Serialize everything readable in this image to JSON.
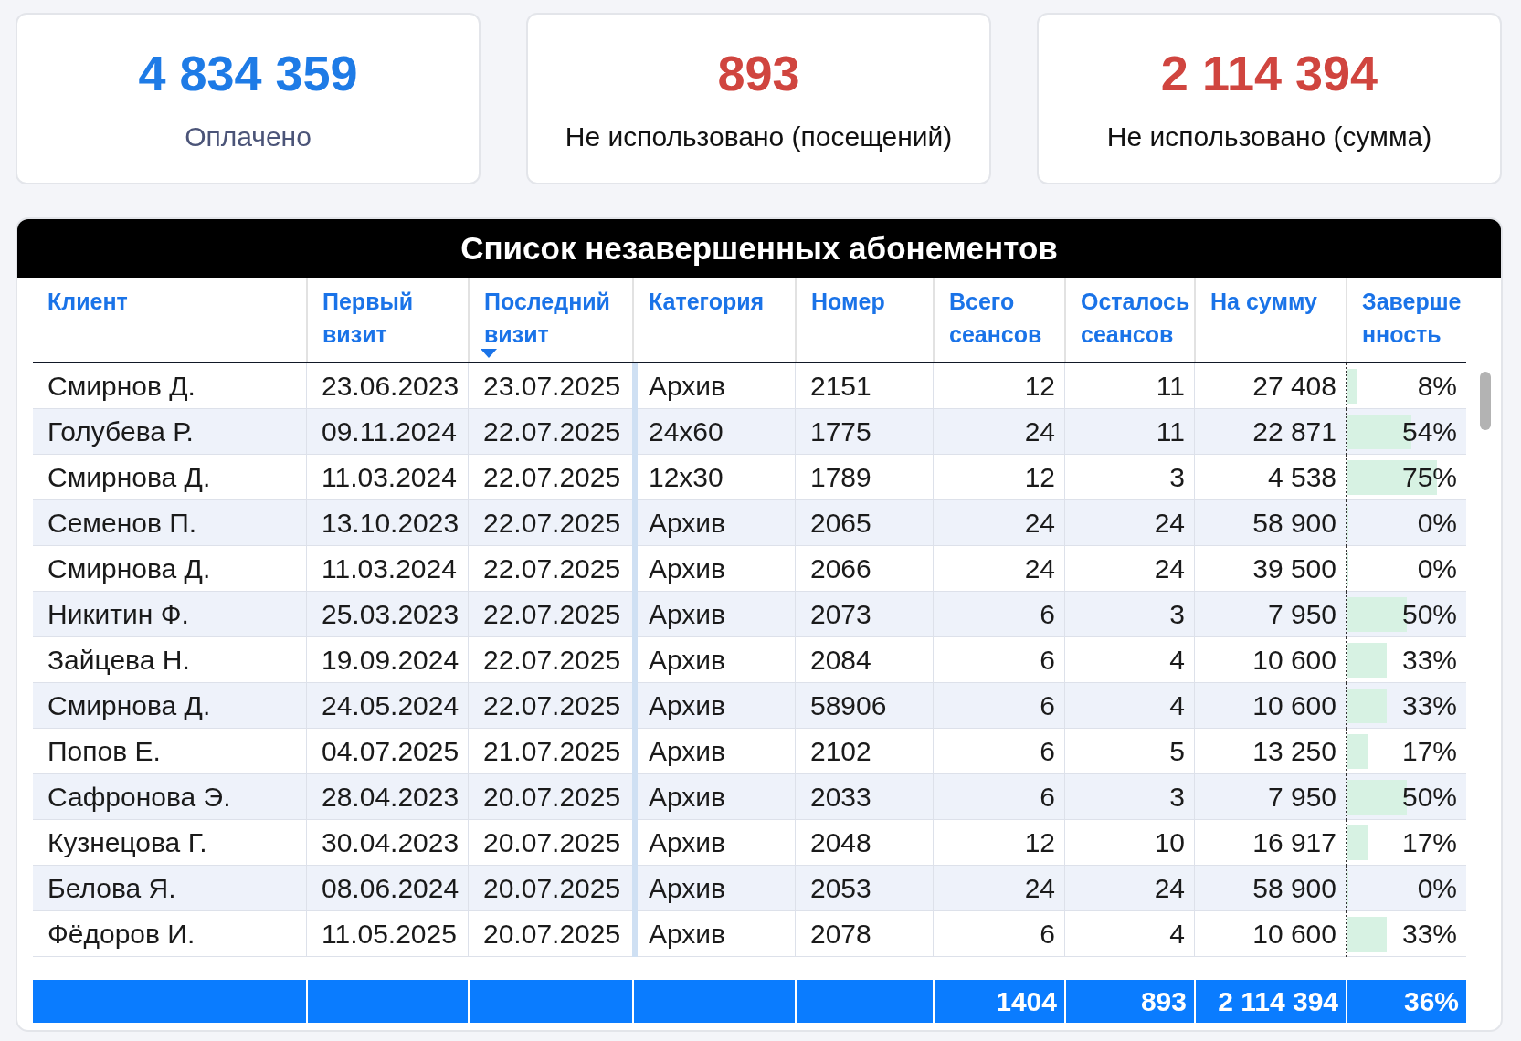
{
  "cards": [
    {
      "value": "4 834 359",
      "label": "Оплачено",
      "color": "#1e7be6",
      "muted": true
    },
    {
      "value": "893",
      "label": "Не использовано (посещений)",
      "color": "#d0453f",
      "muted": false
    },
    {
      "value": "2 114 394",
      "label": "Не использовано (сумма)",
      "color": "#d0453f",
      "muted": false
    }
  ],
  "table": {
    "title": "Список незавершенных абонементов",
    "columns": [
      {
        "label": "Клиент",
        "sorted": false
      },
      {
        "label": "Первый визит",
        "sorted": false
      },
      {
        "label": "Последний визит",
        "sorted": true
      },
      {
        "label": "Категория",
        "sorted": false
      },
      {
        "label": "Номер",
        "sorted": false
      },
      {
        "label": "Всего сеансов",
        "sorted": false
      },
      {
        "label": "Осталось сеансов",
        "sorted": false
      },
      {
        "label": "На сумму",
        "sorted": false
      },
      {
        "label": "Завершенность",
        "sorted": false
      }
    ],
    "rows": [
      {
        "cells": [
          "Смирнов Д.",
          "23.06.2023",
          "23.07.2025",
          "Архив",
          "2151",
          "12",
          "11",
          "27 408"
        ],
        "completion": "8%",
        "level": 0.08
      },
      {
        "cells": [
          "Голубева Р.",
          "09.11.2024",
          "22.07.2025",
          "24x60",
          "1775",
          "24",
          "11",
          "22 871"
        ],
        "completion": "54%",
        "level": 0.54
      },
      {
        "cells": [
          "Смирнова Д.",
          "11.03.2024",
          "22.07.2025",
          "12x30",
          "1789",
          "12",
          "3",
          "4 538"
        ],
        "completion": "75%",
        "level": 0.75
      },
      {
        "cells": [
          "Семенов П.",
          "13.10.2023",
          "22.07.2025",
          "Архив",
          "2065",
          "24",
          "24",
          "58 900"
        ],
        "completion": "0%",
        "level": 0
      },
      {
        "cells": [
          "Смирнова Д.",
          "11.03.2024",
          "22.07.2025",
          "Архив",
          "2066",
          "24",
          "24",
          "39 500"
        ],
        "completion": "0%",
        "level": 0
      },
      {
        "cells": [
          "Никитин Ф.",
          "25.03.2023",
          "22.07.2025",
          "Архив",
          "2073",
          "6",
          "3",
          "7 950"
        ],
        "completion": "50%",
        "level": 0.5
      },
      {
        "cells": [
          "Зайцева Н.",
          "19.09.2024",
          "22.07.2025",
          "Архив",
          "2084",
          "6",
          "4",
          "10 600"
        ],
        "completion": "33%",
        "level": 0.33
      },
      {
        "cells": [
          "Смирнова Д.",
          "24.05.2024",
          "22.07.2025",
          "Архив",
          "58906",
          "6",
          "4",
          "10 600"
        ],
        "completion": "33%",
        "level": 0.33
      },
      {
        "cells": [
          "Попов Е.",
          "04.07.2025",
          "21.07.2025",
          "Архив",
          "2102",
          "6",
          "5",
          "13 250"
        ],
        "completion": "17%",
        "level": 0.17
      },
      {
        "cells": [
          "Сафронова Э.",
          "28.04.2023",
          "20.07.2025",
          "Архив",
          "2033",
          "6",
          "3",
          "7 950"
        ],
        "completion": "50%",
        "level": 0.5
      },
      {
        "cells": [
          "Кузнецова Г.",
          "30.04.2023",
          "20.07.2025",
          "Архив",
          "2048",
          "12",
          "10",
          "16 917"
        ],
        "completion": "17%",
        "level": 0.17
      },
      {
        "cells": [
          "Белова Я.",
          "08.06.2024",
          "20.07.2025",
          "Архив",
          "2053",
          "24",
          "24",
          "58 900"
        ],
        "completion": "0%",
        "level": 0
      },
      {
        "cells": [
          "Фёдоров И.",
          "11.05.2025",
          "20.07.2025",
          "Архив",
          "2078",
          "6",
          "4",
          "10 600"
        ],
        "completion": "33%",
        "level": 0.33
      }
    ],
    "totals": {
      "sessions": "1404",
      "remaining": "893",
      "sum": "2 114 394",
      "completion": "36%"
    }
  }
}
